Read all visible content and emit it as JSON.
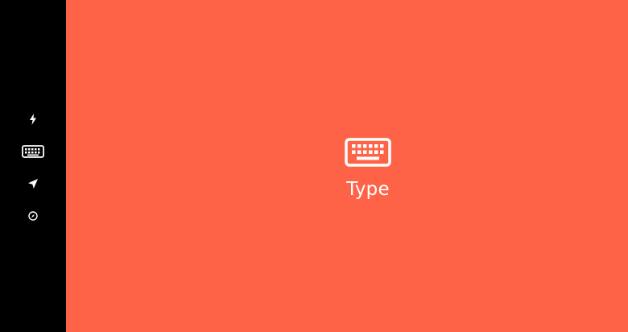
{
  "colors": {
    "sidebar_bg": "#000000",
    "main_bg": "#FF6347",
    "icon_fg": "#FFFFFF"
  },
  "sidebar": {
    "items": [
      {
        "icon": "lightning-icon",
        "selected": false
      },
      {
        "icon": "keyboard-icon",
        "selected": true
      },
      {
        "icon": "navigation-arrow-icon",
        "selected": false
      },
      {
        "icon": "compass-icon",
        "selected": false
      }
    ]
  },
  "main": {
    "icon": "keyboard-icon",
    "label": "Type"
  }
}
